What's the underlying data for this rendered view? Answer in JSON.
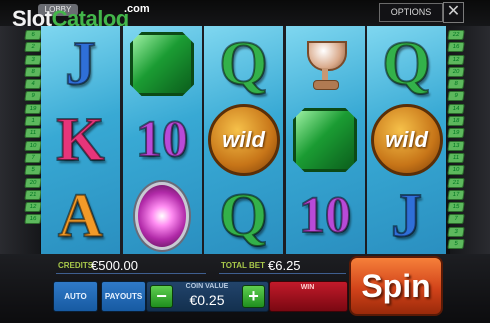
{
  "logo": {
    "part1": "Slot",
    "part2": "Catalog",
    "dot": ".com"
  },
  "topbar": {
    "lobby_label": "LOBBY",
    "options_label": "OPTIONS",
    "close_glyph": "✕"
  },
  "paylines": {
    "left": [
      "6",
      "2",
      "3",
      "8",
      "4",
      "9",
      "19",
      "1",
      "11",
      "10",
      "7",
      "5",
      "20",
      "21",
      "12",
      "16"
    ],
    "right": [
      "22",
      "16",
      "12",
      "20",
      "8",
      "9",
      "14",
      "18",
      "19",
      "13",
      "11",
      "10",
      "21",
      "17",
      "15",
      "7",
      "3",
      "5"
    ]
  },
  "reels": [
    [
      {
        "sym": "J",
        "kind": "letter",
        "cls": "c-j"
      },
      {
        "sym": "K",
        "kind": "letter",
        "cls": "c-k"
      },
      {
        "sym": "A",
        "kind": "letter",
        "cls": "c-a"
      }
    ],
    [
      {
        "sym": "emerald",
        "kind": "emerald"
      },
      {
        "sym": "10",
        "kind": "letter",
        "cls": "c-10"
      },
      {
        "sym": "pink-gem",
        "kind": "pinkgem"
      }
    ],
    [
      {
        "sym": "Q",
        "kind": "letter",
        "cls": "c-q"
      },
      {
        "sym": "wild",
        "kind": "wild",
        "label": "wild"
      },
      {
        "sym": "Q",
        "kind": "letter",
        "cls": "c-q"
      }
    ],
    [
      {
        "sym": "trophy",
        "kind": "cup"
      },
      {
        "sym": "emerald",
        "kind": "emerald"
      },
      {
        "sym": "10",
        "kind": "letter",
        "cls": "c-10"
      }
    ],
    [
      {
        "sym": "Q",
        "kind": "letter",
        "cls": "c-q"
      },
      {
        "sym": "wild",
        "kind": "wild",
        "label": "wild"
      },
      {
        "sym": "J",
        "kind": "letter",
        "cls": "c-j"
      }
    ]
  ],
  "status": {
    "credits_label": "CREDITS",
    "credits_value": "€500.00",
    "total_bet_label": "TOTAL BET",
    "total_bet_value": "€6.25"
  },
  "controls": {
    "auto_label": "AUTO",
    "payouts_label": "PAYOUTS",
    "coin_value_label": "COIN VALUE",
    "coin_value": "€0.25",
    "minus_glyph": "−",
    "plus_glyph": "+",
    "win_label": "WIN",
    "spin_label": "Spin"
  }
}
